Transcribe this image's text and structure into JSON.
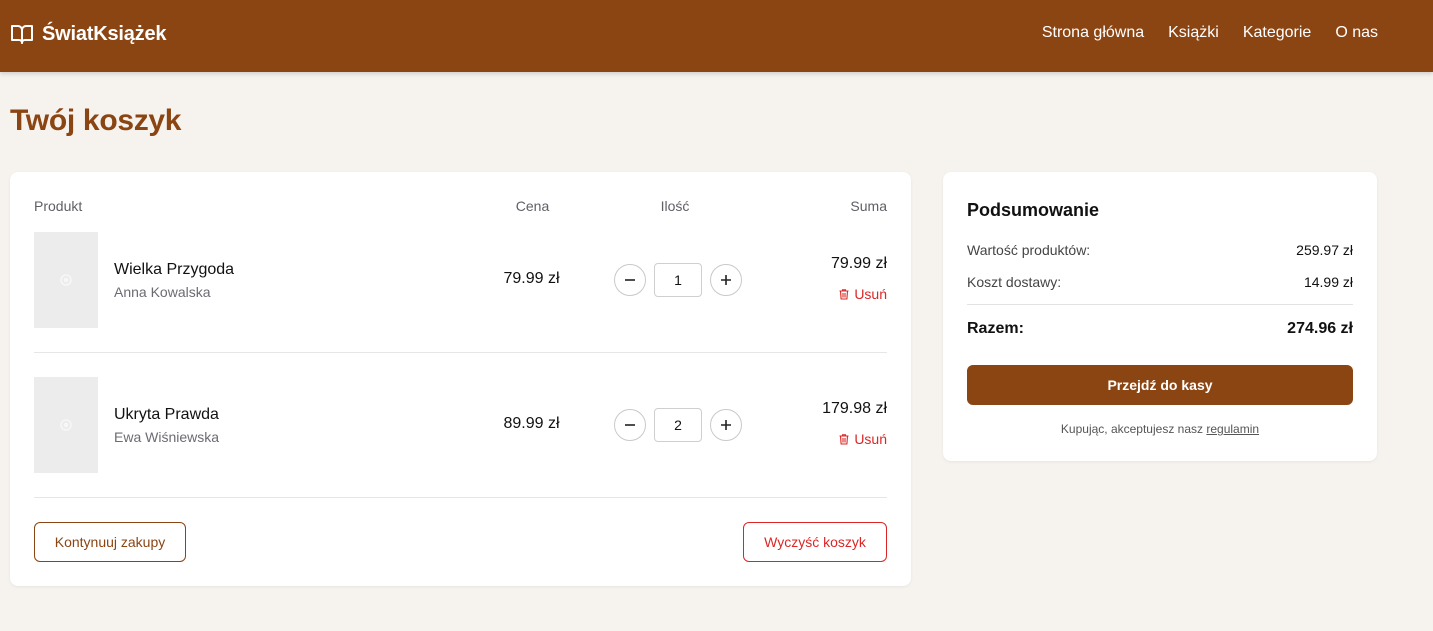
{
  "brand": {
    "name": "ŚwiatKsiążek",
    "icon": "open-book-icon",
    "color": "#8b4513"
  },
  "nav": [
    {
      "label": "Strona główna"
    },
    {
      "label": "Książki"
    },
    {
      "label": "Kategorie"
    },
    {
      "label": "O nas"
    }
  ],
  "page": {
    "title": "Twój koszyk"
  },
  "cart": {
    "headers": {
      "product": "Produkt",
      "price": "Cena",
      "quantity": "Ilość",
      "total": "Suma"
    },
    "items": [
      {
        "title": "Wielka Przygoda",
        "author": "Anna Kowalska",
        "price": "79.99 zł",
        "quantity": "1",
        "total": "79.99 zł",
        "remove_label": "Usuń"
      },
      {
        "title": "Ukryta Prawda",
        "author": "Ewa Wiśniewska",
        "price": "89.99 zł",
        "quantity": "2",
        "total": "179.98 zł",
        "remove_label": "Usuń"
      }
    ],
    "continue_label": "Kontynuuj zakupy",
    "clear_label": "Wyczyść koszyk"
  },
  "summary": {
    "title": "Podsumowanie",
    "products_label": "Wartość produktów:",
    "products_value": "259.97 zł",
    "shipping_label": "Koszt dostawy:",
    "shipping_value": "14.99 zł",
    "total_label": "Razem:",
    "total_value": "274.96 zł",
    "checkout_label": "Przejdź do kasy",
    "terms_text": "Kupując, akceptujesz nasz",
    "terms_link": "regulamin"
  },
  "colors": {
    "accent": "#8b4513",
    "danger": "#dc2626",
    "background": "#f6f3ef"
  }
}
